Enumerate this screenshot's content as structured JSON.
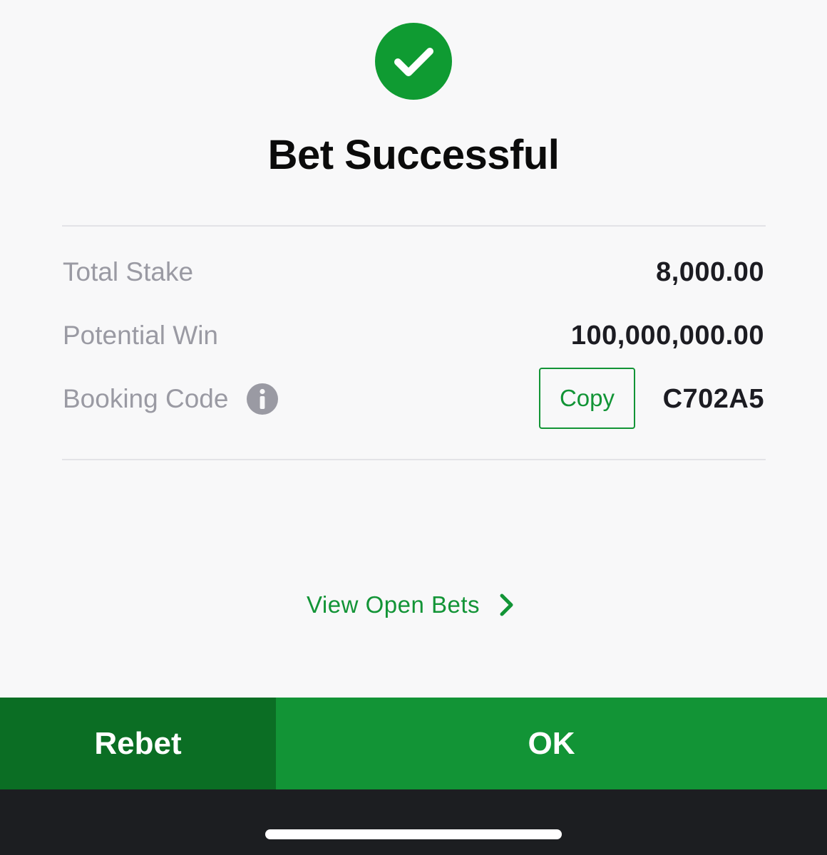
{
  "status": {
    "title": "Bet Successful",
    "icon": "check-circle-icon",
    "icon_color": "#129436"
  },
  "summary": {
    "total_stake_label": "Total Stake",
    "total_stake_value": "8,000.00",
    "potential_win_label": "Potential Win",
    "potential_win_value": "100,000,000.00",
    "booking_code_label": "Booking Code",
    "booking_code_info_icon": "info-icon",
    "copy_label": "Copy",
    "booking_code_value": "C702A5"
  },
  "links": {
    "view_open_bets": "View Open Bets",
    "chevron_icon": "chevron-right-icon"
  },
  "footer": {
    "rebet_label": "Rebet",
    "ok_label": "OK"
  },
  "colors": {
    "brand_green": "#129436",
    "dark_green": "#0b6e24",
    "background": "#f8f8f9",
    "label_gray": "#9a9aa3",
    "value_dark": "#1c1c22"
  }
}
